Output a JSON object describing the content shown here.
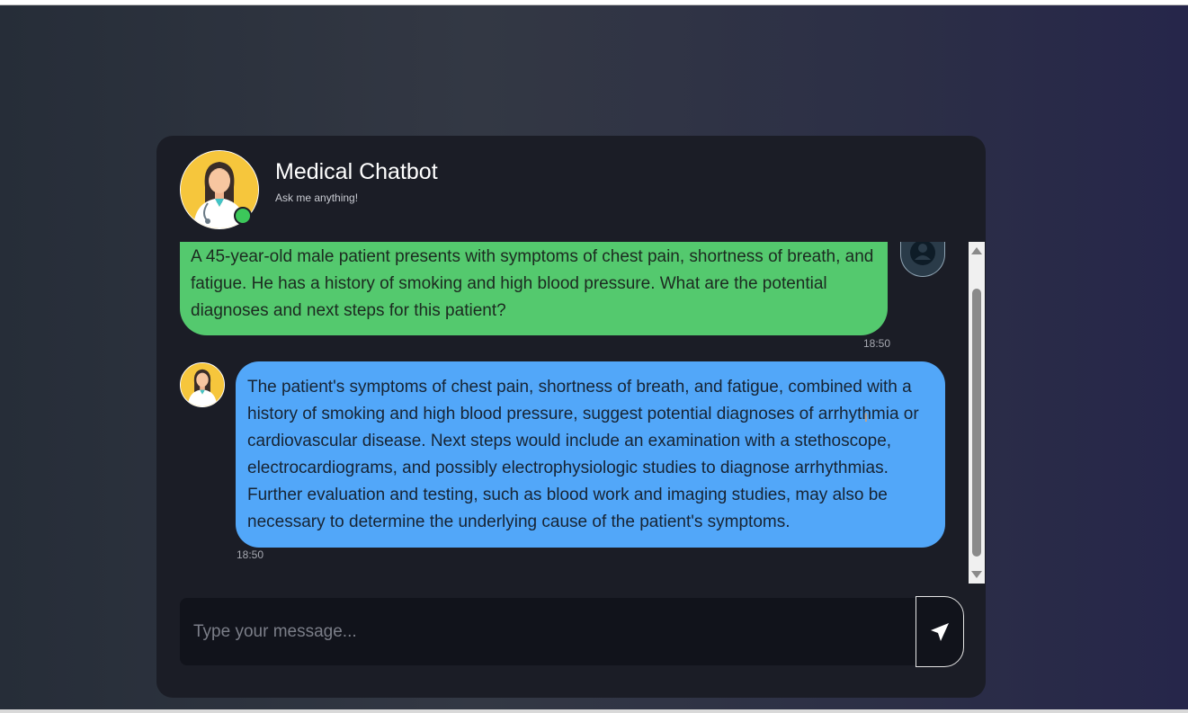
{
  "header": {
    "title": "Medical Chatbot",
    "subtitle": "Ask me anything!"
  },
  "messages": [
    {
      "sender": "user",
      "text": "A 45-year-old male patient presents with symptoms of chest pain, shortness of breath, and fatigue. He has a history of smoking and high blood pressure. What are the potential diagnoses and next steps for this patient?",
      "time": "18:50"
    },
    {
      "sender": "bot",
      "text": "The patient's symptoms of chest pain, shortness of breath, and fatigue, combined with a history of smoking and high blood pressure, suggest potential diagnoses of arrhythmia or cardiovascular disease. Next steps would include an examination with a stethoscope, electrocardiograms, and possibly electrophysiologic studies to diagnose arrhythmias. Further evaluation and testing, such as blood work and imaging studies, may also be necessary to determine the underlying cause of the patient's symptoms.",
      "time": "18:50"
    }
  ],
  "composer": {
    "placeholder": "Type your message...",
    "value": ""
  },
  "icons": {
    "send": "send-arrow-icon",
    "user": "user-avatar-icon",
    "doctor": "doctor-avatar-icon",
    "online": "online-status-icon"
  },
  "colors": {
    "user_bubble": "#54c96e",
    "bot_bubble": "#52a7f9",
    "card_bg": "#1b1d26",
    "online": "#3cc75a"
  }
}
